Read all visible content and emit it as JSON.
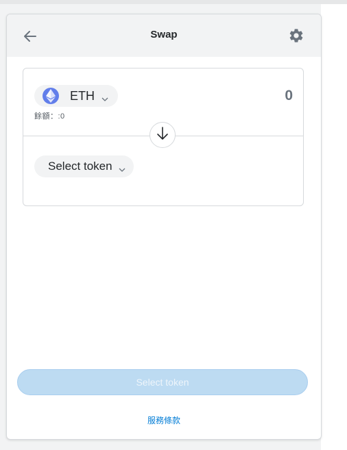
{
  "header": {
    "title": "Swap",
    "back_icon": "arrow-left-icon",
    "settings_icon": "gear-icon"
  },
  "from": {
    "token_symbol": "ETH",
    "token_icon": "ethereum-icon",
    "balance_text": "餘額：:0",
    "amount": "0"
  },
  "switch_icon": "arrow-down-icon",
  "to": {
    "select_label": "Select token"
  },
  "footer": {
    "primary_button_label": "Select token",
    "terms_link": "服務條款"
  },
  "colors": {
    "accent": "#037dd6",
    "disabled_button_bg": "#bddbf2",
    "eth_blue": "#627eea",
    "header_bg": "#f2f3f4"
  }
}
